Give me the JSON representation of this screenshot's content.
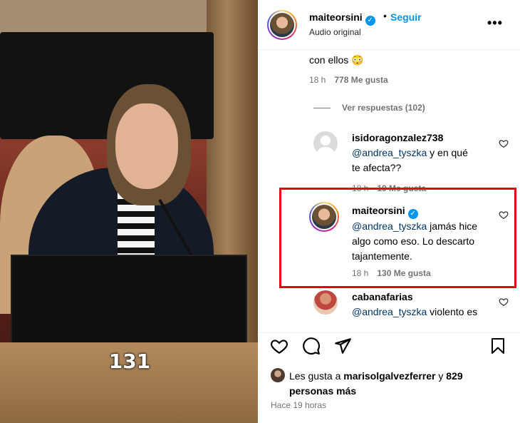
{
  "post": {
    "username": "maiteorsini",
    "separator": "•",
    "follow_label": "Seguir",
    "subtitle": "Audio original",
    "more_label": "•••"
  },
  "video": {
    "counter": "131"
  },
  "comments": {
    "prev_text": "con ellos 😳",
    "prev_time": "18 h",
    "prev_likes": "778 Me gusta",
    "view_replies": "Ver respuestas (102)",
    "items": [
      {
        "user": "isidoragonzalez738",
        "mention": "@andrea_tyszka",
        "text_line1": " y en qué",
        "text_line2": "te afecta??",
        "time": "18 h",
        "likes": "19 Me gusta"
      },
      {
        "user": "maiteorsini",
        "mention": "@andrea_tyszka",
        "text_line1": " jamás hice",
        "text_line2": "algo como eso. Lo descarto",
        "text_line3": "tajantemente.",
        "time": "18 h",
        "likes": "130 Me gusta"
      },
      {
        "user": "cabanafarias",
        "mention": "@andrea_tyszka",
        "text_line1": " violento es"
      }
    ]
  },
  "actions": {
    "likes_prefix": "Les gusta a ",
    "likes_user": "marisolgalvezferrer",
    "likes_mid": " y ",
    "likes_count": "829",
    "likes_suffix": "personas más",
    "time_ago": "Hace 19 horas"
  },
  "colors": {
    "accent": "#0095f6",
    "highlight": "#e30613",
    "mention": "#00376b",
    "muted": "#737373"
  },
  "icons": [
    "heart-icon",
    "comment-icon",
    "share-icon",
    "bookmark-icon",
    "more-icon",
    "verified-icon"
  ]
}
